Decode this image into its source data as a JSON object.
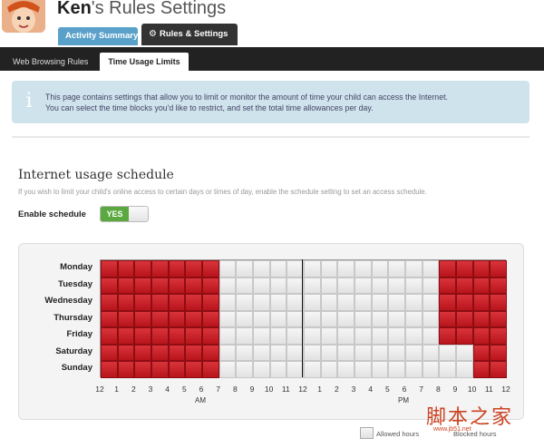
{
  "header": {
    "title_name": "Ken",
    "title_rest": "'s Rules Settings",
    "tabs": [
      {
        "label": "Activity Summary",
        "icon": ""
      },
      {
        "label": "Rules & Settings",
        "icon": "gear-icon"
      }
    ]
  },
  "subtabs": [
    {
      "label": "Web Browsing Rules"
    },
    {
      "label": "Time Usage Limits"
    }
  ],
  "info": {
    "line1": "This page contains settings that allow you to limit or monitor the amount of time your child can access the Internet.",
    "line2": "You can select the time blocks you'd like to restrict, and set the total time allowances per day."
  },
  "schedule": {
    "title": "Internet usage schedule",
    "description": "If you wish to limit your child's online access to certain days or times of day, enable the schedule setting to set an access schedule.",
    "enable_label": "Enable schedule",
    "toggle_value": "YES",
    "days": [
      "Monday",
      "Tuesday",
      "Wednesday",
      "Thursday",
      "Friday",
      "Saturday",
      "Sunday"
    ],
    "hours": [
      "12",
      "1",
      "2",
      "3",
      "4",
      "5",
      "6",
      "7",
      "8",
      "9",
      "10",
      "11",
      "12",
      "1",
      "2",
      "3",
      "4",
      "5",
      "6",
      "7",
      "8",
      "9",
      "10",
      "11",
      "12"
    ],
    "am_label": "AM",
    "pm_label": "PM",
    "blocked_hours": [
      [
        0,
        1,
        2,
        3,
        4,
        5,
        6,
        20,
        21,
        22,
        23
      ],
      [
        0,
        1,
        2,
        3,
        4,
        5,
        6,
        20,
        21,
        22,
        23
      ],
      [
        0,
        1,
        2,
        3,
        4,
        5,
        6,
        20,
        21,
        22,
        23
      ],
      [
        0,
        1,
        2,
        3,
        4,
        5,
        6,
        20,
        21,
        22,
        23
      ],
      [
        0,
        1,
        2,
        3,
        4,
        5,
        6,
        20,
        21,
        22,
        23
      ],
      [
        0,
        1,
        2,
        3,
        4,
        5,
        6,
        22,
        23
      ],
      [
        0,
        1,
        2,
        3,
        4,
        5,
        6,
        22,
        23
      ]
    ],
    "colors": {
      "blocked": "#c8202a",
      "allowed": "#ececec"
    }
  },
  "legend": {
    "allowed_label": "Allowed hours",
    "blocked_label": "Blocked hours"
  },
  "watermark": {
    "text": "脚本之家",
    "sub": "www.jb51.net"
  }
}
